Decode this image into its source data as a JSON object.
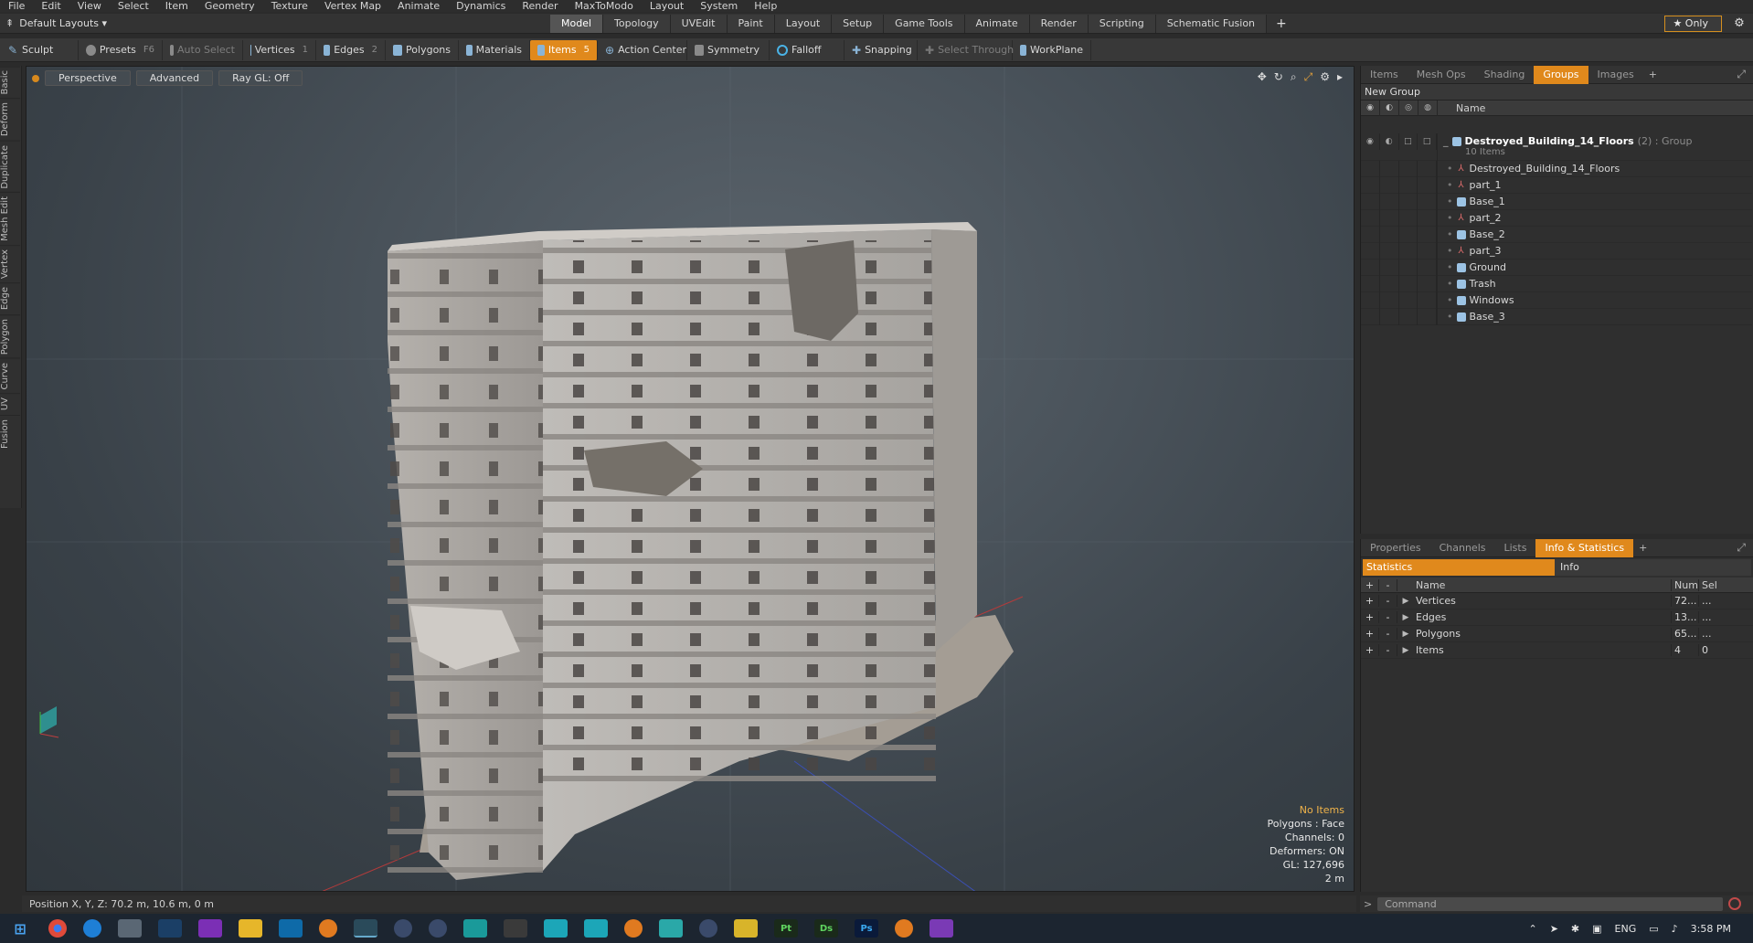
{
  "menu": [
    "File",
    "Edit",
    "View",
    "Select",
    "Item",
    "Geometry",
    "Texture",
    "Vertex Map",
    "Animate",
    "Dynamics",
    "Render",
    "MaxToModo",
    "Layout",
    "System",
    "Help"
  ],
  "layouts": {
    "label": "Default Layouts ▾"
  },
  "tabs": [
    {
      "label": "Model",
      "active": true
    },
    {
      "label": "Topology"
    },
    {
      "label": "UVEdit"
    },
    {
      "label": "Paint"
    },
    {
      "label": "Layout"
    },
    {
      "label": "Setup"
    },
    {
      "label": "Game Tools"
    },
    {
      "label": "Animate"
    },
    {
      "label": "Render"
    },
    {
      "label": "Scripting"
    },
    {
      "label": "Schematic Fusion"
    }
  ],
  "tab_plus": "+",
  "only_label": "★ Only",
  "toolbar": {
    "sculpt": "Sculpt",
    "presets": "Presets",
    "presets_key": "F6",
    "auto_select": "Auto Select",
    "vertices": "Vertices",
    "vertices_key": "1",
    "edges": "Edges",
    "edges_key": "2",
    "polygons": "Polygons",
    "materials": "Materials",
    "items": "Items",
    "items_key": "5",
    "action_center": "Action Center",
    "symmetry": "Symmetry",
    "falloff": "Falloff",
    "snapping": "Snapping",
    "select_through": "Select Through",
    "workplane": "WorkPlane"
  },
  "left_tabs": [
    "Basic",
    "Deform",
    "Duplicate",
    "Mesh Edit",
    "Vertex",
    "Edge",
    "Polygon",
    "Curve",
    "UV",
    "Fusion"
  ],
  "viewport": {
    "view": "Perspective",
    "mode": "Advanced",
    "raygl": "Ray GL: Off",
    "info": {
      "selection": "No Items",
      "polygons": "Polygons : Face",
      "channels": "Channels: 0",
      "deformers": "Deformers: ON",
      "gl": "GL: 127,696",
      "scale": "2 m"
    }
  },
  "status_position": "Position X, Y, Z:  70.2 m, 10.6 m, 0 m",
  "top_panel": {
    "tabs": [
      {
        "label": "Items"
      },
      {
        "label": "Mesh Ops"
      },
      {
        "label": "Shading"
      },
      {
        "label": "Groups",
        "active": true
      },
      {
        "label": "Images"
      }
    ],
    "new_group": "New Group",
    "name_header": "Name",
    "group": {
      "name": "Destroyed_Building_14_Floors",
      "suffix": "(2) : Group",
      "count": "10 Items"
    },
    "children": [
      {
        "name": "Destroyed_Building_14_Floors",
        "kind": "locator"
      },
      {
        "name": "part_1",
        "kind": "locator"
      },
      {
        "name": "Base_1",
        "kind": "mesh"
      },
      {
        "name": "part_2",
        "kind": "locator"
      },
      {
        "name": "Base_2",
        "kind": "mesh"
      },
      {
        "name": "part_3",
        "kind": "locator"
      },
      {
        "name": "Ground",
        "kind": "mesh"
      },
      {
        "name": "Trash",
        "kind": "mesh"
      },
      {
        "name": "Windows",
        "kind": "mesh"
      },
      {
        "name": "Base_3",
        "kind": "mesh"
      }
    ]
  },
  "bottom_panel": {
    "tabs": [
      {
        "label": "Properties"
      },
      {
        "label": "Channels"
      },
      {
        "label": "Lists"
      },
      {
        "label": "Info & Statistics",
        "active": true
      }
    ],
    "statistics_tab": "Statistics",
    "info_tab": "Info",
    "headers": {
      "name": "Name",
      "num": "Num",
      "sel": "Sel"
    },
    "rows": [
      {
        "name": "Vertices",
        "num": "72...",
        "sel": "..."
      },
      {
        "name": "Edges",
        "num": "13...",
        "sel": "..."
      },
      {
        "name": "Polygons",
        "num": "65...",
        "sel": "..."
      },
      {
        "name": "Items",
        "num": "4",
        "sel": "0"
      }
    ]
  },
  "command_placeholder": "Command",
  "taskbar": {
    "language": "ENG",
    "time": "3:58 PM"
  },
  "colors": {
    "accent": "#e0891c",
    "viewport_bg": "#4a535b"
  }
}
